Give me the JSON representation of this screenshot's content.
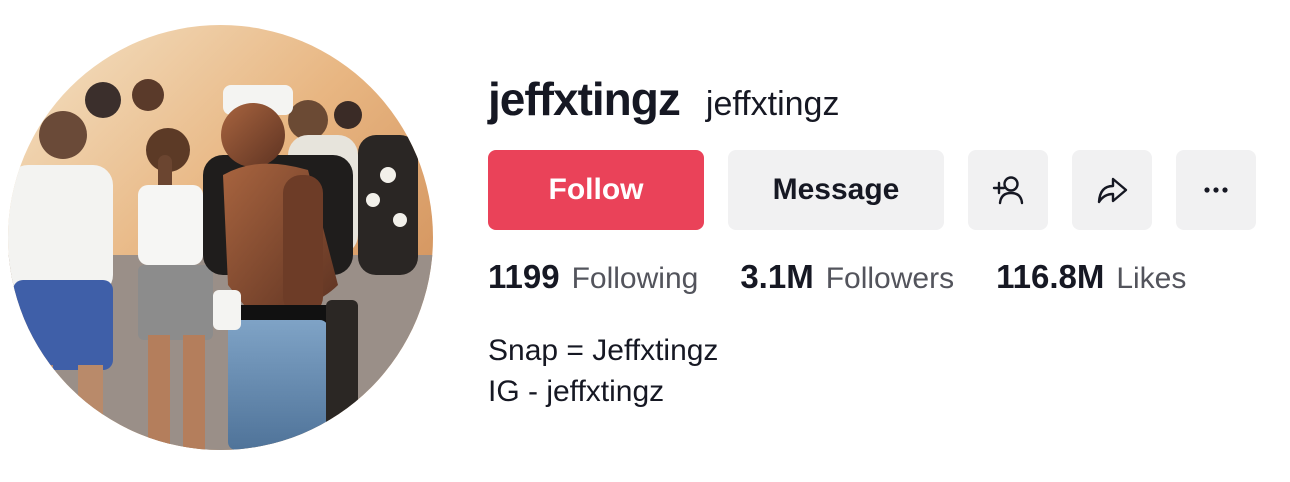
{
  "profile": {
    "username": "jeffxtingz",
    "nickname": "jeffxtingz"
  },
  "actions": {
    "follow_label": "Follow",
    "message_label": "Message",
    "add_friend_icon": "add-user-icon",
    "share_icon": "share-icon",
    "more_icon": "more-icon"
  },
  "stats": {
    "following": {
      "count": "1199",
      "label": "Following"
    },
    "followers": {
      "count": "3.1M",
      "label": "Followers"
    },
    "likes": {
      "count": "116.8M",
      "label": "Likes"
    }
  },
  "bio": {
    "line1": "Snap = Jeffxtingz",
    "line2": "IG - jeffxtingz"
  },
  "colors": {
    "follow_bg": "#ea4259",
    "button_bg": "#f1f1f2",
    "text": "#161823",
    "secondary_text": "#53545c"
  }
}
